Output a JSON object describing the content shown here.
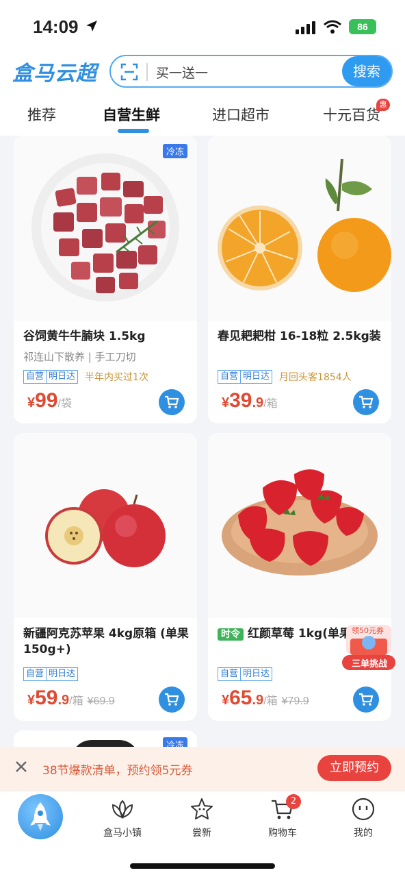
{
  "status": {
    "time": "14:09",
    "battery": "86"
  },
  "header": {
    "logo": "盒马云超",
    "search_placeholder": "买一送一",
    "search_button": "搜索"
  },
  "tabs": [
    {
      "label": "推荐"
    },
    {
      "label": "自营生鲜"
    },
    {
      "label": "进口超市"
    },
    {
      "label": "十元百货",
      "badge": "惠"
    }
  ],
  "products": [
    {
      "title": "谷饲黄牛牛腩块 1.5kg",
      "subtitle": "祁连山下散养 | 手工刀切",
      "tags": [
        "自营",
        "明日达"
      ],
      "note": "半年内买过1次",
      "badge": "冷冻",
      "price_int": "99",
      "price_dec": "",
      "unit": "/袋",
      "old_price": ""
    },
    {
      "title": "春见耙耙柑 16-18粒 2.5kg装",
      "subtitle": "",
      "tags": [
        "自营",
        "明日达"
      ],
      "note": "月回头客1854人",
      "badge": "",
      "price_int": "39",
      "price_dec": ".9",
      "unit": "/箱",
      "old_price": ""
    },
    {
      "title": "新疆阿克苏苹果 4kg原箱 (单果150g+)",
      "subtitle": "",
      "tags": [
        "自营",
        "明日达"
      ],
      "note": "",
      "badge": "",
      "price_int": "59",
      "price_dec": ".9",
      "unit": "/箱",
      "old_price": "¥69.9"
    },
    {
      "title": "红颜草莓 1kg(单果15g)",
      "title_prefix": "时令",
      "subtitle": "",
      "tags": [
        "自营",
        "明日达"
      ],
      "note": "",
      "badge": "",
      "price_int": "65",
      "price_dec": ".9",
      "unit": "/箱",
      "old_price": "¥79.9"
    }
  ],
  "peek_badge": "冷冻",
  "float_promo": {
    "top": "领50元券",
    "bottom": "三单挑战"
  },
  "promo": {
    "text": "38节爆款清单，预约领5元券",
    "button": "立即预约"
  },
  "nav": [
    {
      "label": "盒马小镇"
    },
    {
      "label": "尝新"
    },
    {
      "label": "购物车",
      "badge": "2"
    },
    {
      "label": "我的"
    }
  ],
  "currency": "¥"
}
